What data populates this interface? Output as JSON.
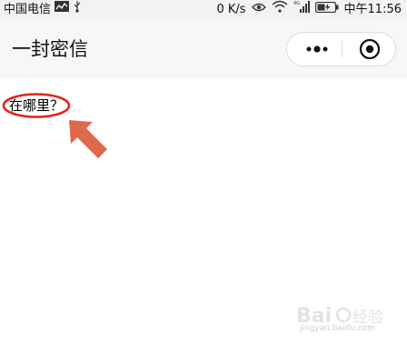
{
  "status_bar": {
    "carrier": "中国电信",
    "network_speed": "0 K/s",
    "network_type_badge": "4G",
    "clock": "中午11:56"
  },
  "mini_program": {
    "title": "一封密信"
  },
  "page": {
    "question": "在哪里？"
  },
  "watermark": {
    "brand": "Baidu 经验",
    "url": "jingyan.baidu.com"
  },
  "colors": {
    "annotation_red": "#e0241e",
    "annotation_arrow": "#e0684a",
    "status_bar_bg": "#f2f2f2",
    "nav_bar_bg": "#f7f7f7"
  }
}
